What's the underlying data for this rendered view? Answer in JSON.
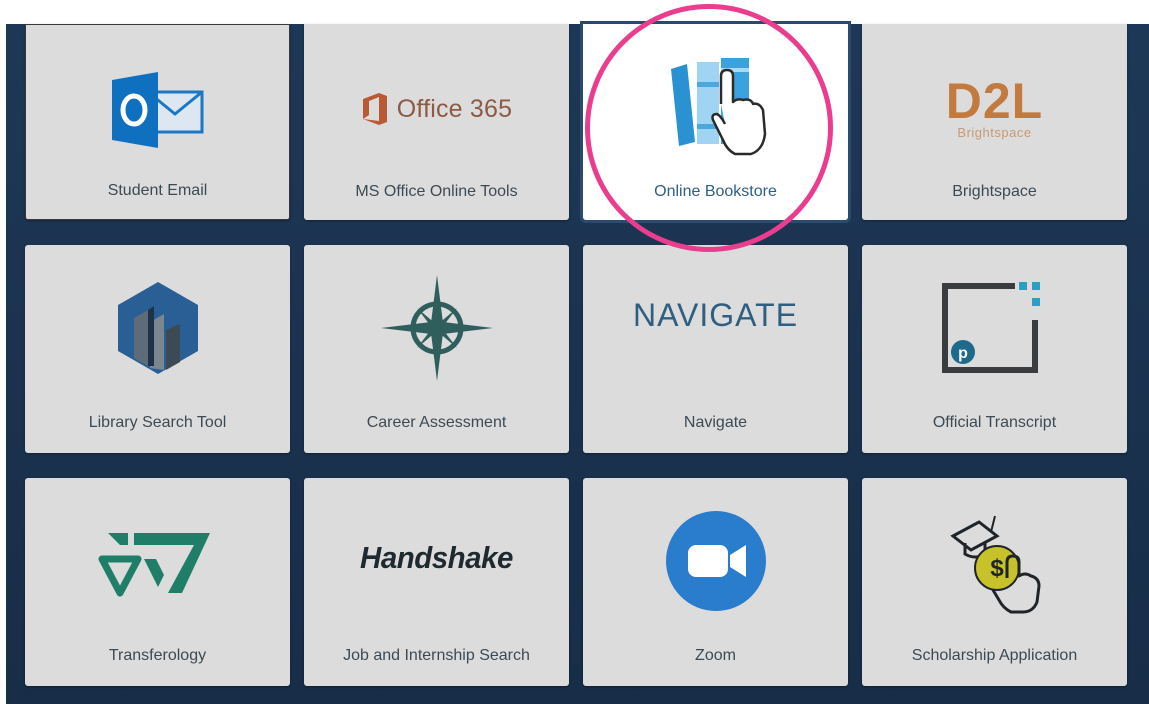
{
  "tiles": [
    {
      "id": "student-email",
      "label": "Student Email"
    },
    {
      "id": "ms-office",
      "label": "MS Office Online Tools",
      "logo_text": "Office 365"
    },
    {
      "id": "bookstore",
      "label": "Online Bookstore",
      "state": "highlighted"
    },
    {
      "id": "brightspace",
      "label": "Brightspace",
      "logo_text": "D2L",
      "logo_subtext": "Brightspace"
    },
    {
      "id": "library",
      "label": "Library Search Tool"
    },
    {
      "id": "career",
      "label": "Career Assessment"
    },
    {
      "id": "navigate",
      "label": "Navigate",
      "logo_text": "NAVIGATE"
    },
    {
      "id": "transcript",
      "label": "Official Transcript"
    },
    {
      "id": "transferology",
      "label": "Transferology"
    },
    {
      "id": "handshake",
      "label": "Job and Internship Search",
      "logo_text": "Handshake"
    },
    {
      "id": "zoom",
      "label": "Zoom"
    },
    {
      "id": "scholarship",
      "label": "Scholarship Application"
    }
  ],
  "annotation": {
    "shape": "circle",
    "color": "#ea3d8e",
    "target": "Online Bookstore"
  },
  "colors": {
    "background": "#1b3350",
    "tile": "#dcdcdc",
    "highlight_tile": "#ffffff"
  }
}
